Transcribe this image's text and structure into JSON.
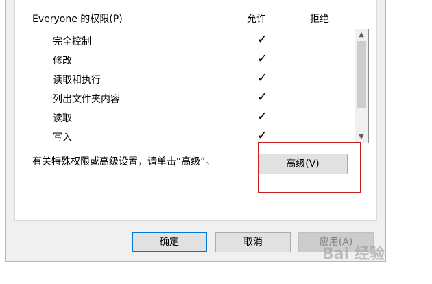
{
  "permissions": {
    "title": "Everyone 的权限(P)",
    "allow_label": "允许",
    "deny_label": "拒绝",
    "rows": [
      {
        "name": "完全控制",
        "allow": "✓"
      },
      {
        "name": "修改",
        "allow": "✓"
      },
      {
        "name": "读取和执行",
        "allow": "✓"
      },
      {
        "name": "列出文件夹内容",
        "allow": "✓"
      },
      {
        "name": "读取",
        "allow": "✓"
      },
      {
        "name": "写入",
        "allow": "✓"
      }
    ]
  },
  "hint_text": "有关特殊权限或高级设置，请单击“高级”。",
  "buttons": {
    "advanced": "高级(V)",
    "ok": "确定",
    "cancel": "取消",
    "apply": "应用(A)"
  },
  "scrollbar": {
    "up_icon": "chevron-up-icon",
    "down_icon": "chevron-down-icon"
  },
  "watermark": "Bai 经验",
  "colors": {
    "highlight": "#c81e1e",
    "focus": "#0078d7"
  }
}
